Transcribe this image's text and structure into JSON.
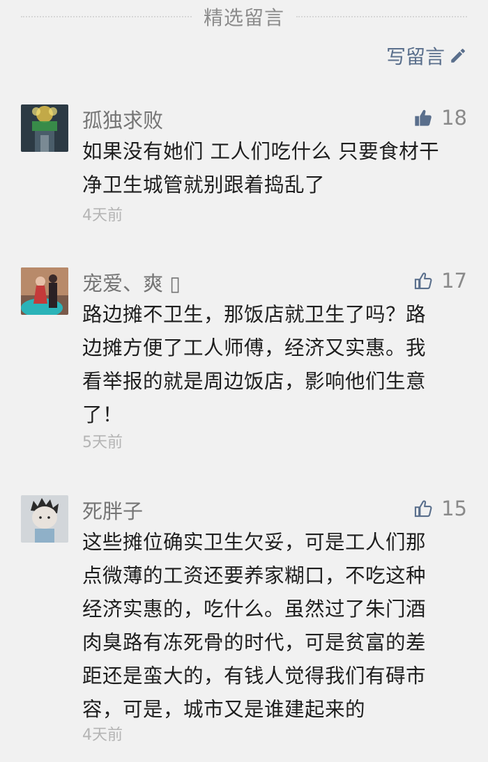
{
  "header": {
    "title": "精选留言"
  },
  "write_button": {
    "label": "写留言",
    "icon": "pencil-icon"
  },
  "comments": [
    {
      "nickname": "孤独求败",
      "likes": "18",
      "liked": true,
      "content_lines": [
        "如果没有她们 工人们吃什么 只要食材干",
        "净卫生城管就别跟着捣乱了"
      ],
      "time": "4天前"
    },
    {
      "nickname": "宠爱、爽 ▯",
      "likes": "17",
      "liked": false,
      "content_lines": [
        "路边摊不卫生，那饭店就卫生了吗？路",
        "边摊方便了工人师傅，经济又实惠。我",
        "看举报的就是周边饭店，影响他们生意",
        "了！"
      ],
      "time": "5天前"
    },
    {
      "nickname": "死胖子",
      "likes": "15",
      "liked": false,
      "content_lines": [
        "这些摊位确实卫生欠妥，可是工人们那",
        "点微薄的工资还要养家糊口，不吃这种",
        "经济实惠的，吃什么。虽然过了朱门酒",
        "肉臭路有冻死骨的时代，可是贫富的差",
        "距还是蛮大的，有钱人觉得我们有碍市",
        "容，可是，城市又是谁建起来的"
      ],
      "time": "4天前"
    }
  ],
  "colors": {
    "background": "#f1f1f1",
    "link": "#5a6f8c",
    "like_active": "#5a6f8c",
    "like_inactive": "#5a6f8c"
  }
}
